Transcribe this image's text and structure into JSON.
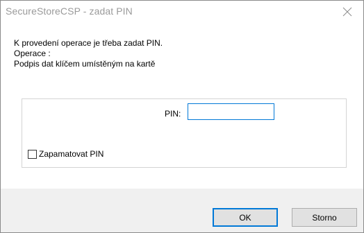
{
  "window": {
    "title": "SecureStoreCSP - zadat PIN",
    "close_icon": "close-icon"
  },
  "message": {
    "line1": "K provedení operace je třeba zadat PIN.",
    "line2": "Operace :",
    "line3": "Podpis dat klíčem umístěným na kartě"
  },
  "pin": {
    "label": "PIN:",
    "value": ""
  },
  "remember": {
    "label": "Zapamatovat PIN",
    "checked": false
  },
  "buttons": {
    "ok_label": "OK",
    "cancel_label": "Storno"
  },
  "colors": {
    "accent": "#0078d7",
    "title_text": "#9a9a9a",
    "footer_bg": "#f0f0f0"
  }
}
